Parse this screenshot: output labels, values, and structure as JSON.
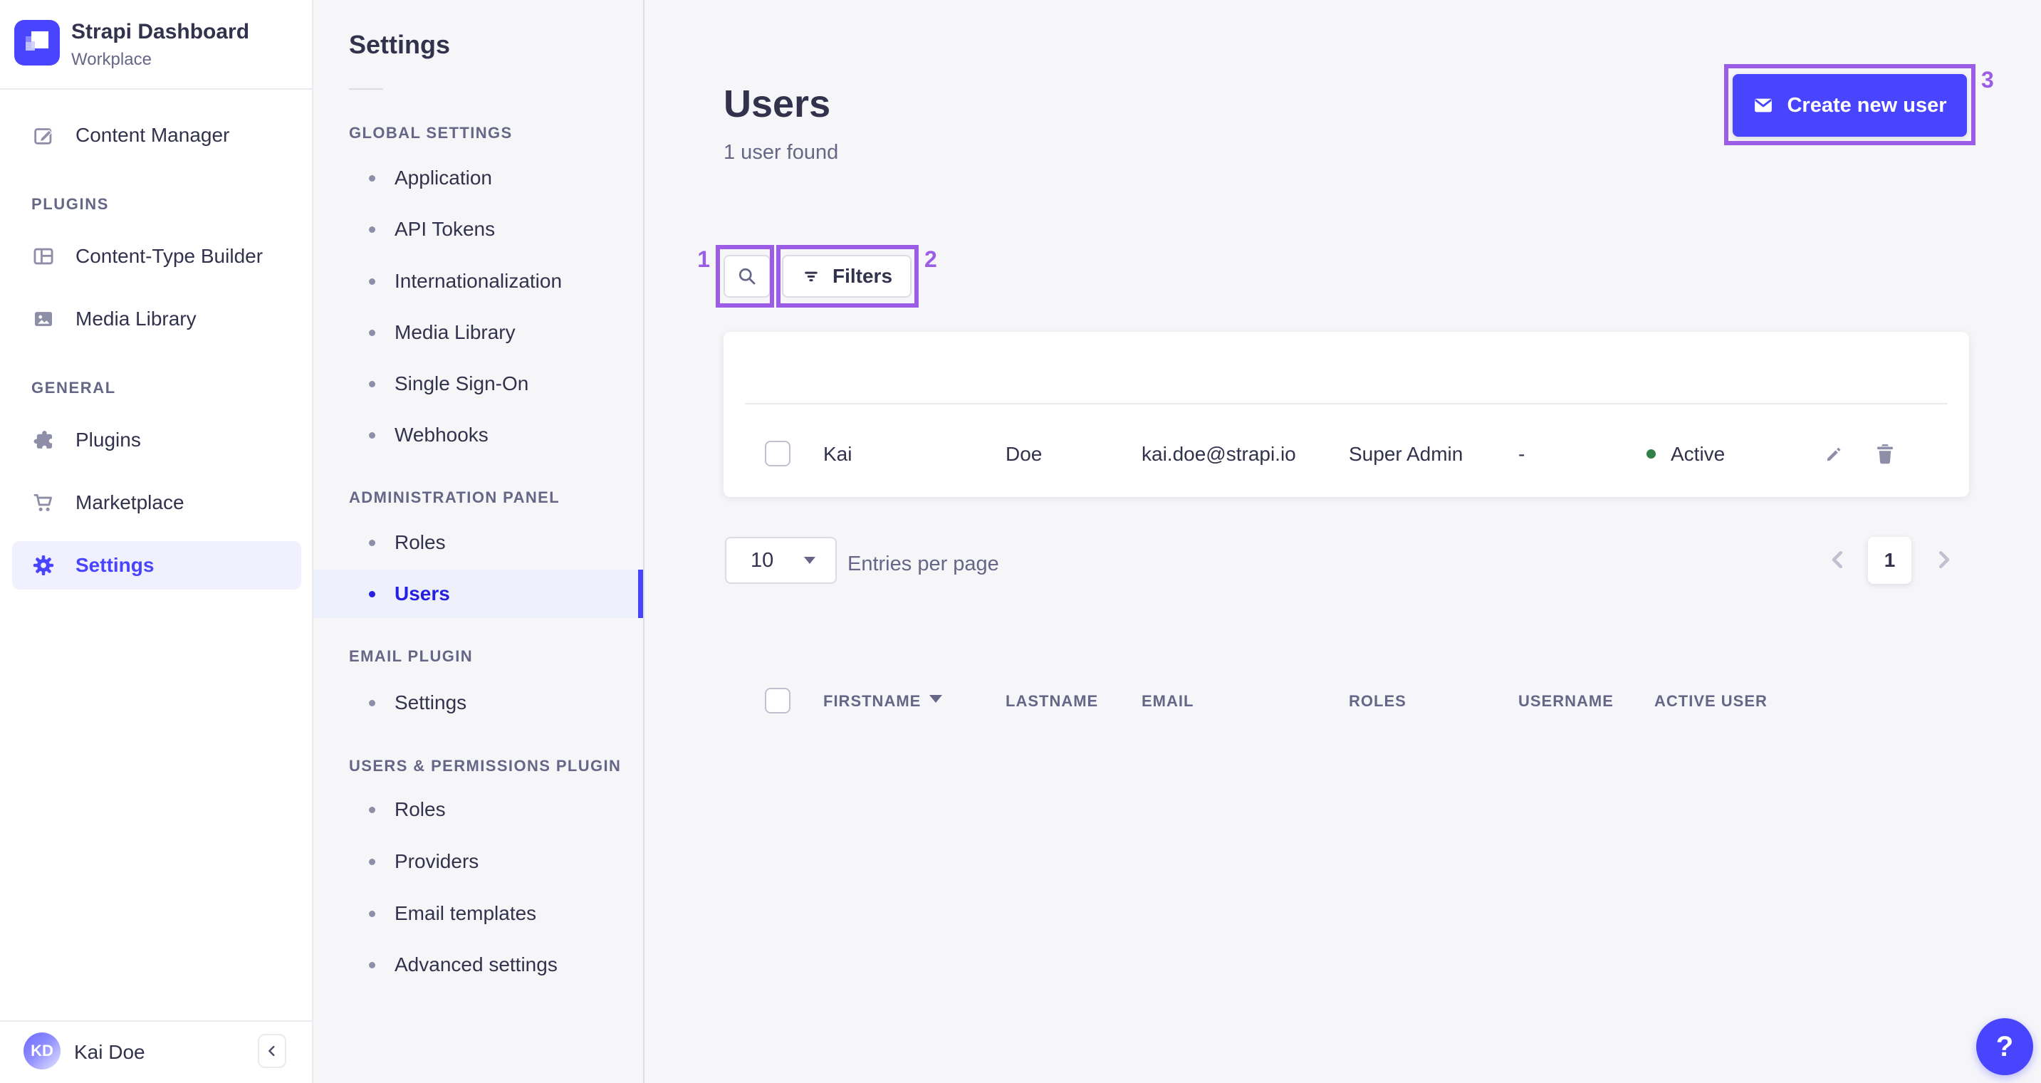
{
  "app": {
    "name": "Strapi Dashboard",
    "workspace": "Workplace"
  },
  "colors": {
    "accent": "#4945ff",
    "active_text": "#271fe0",
    "annotation": "#9b5de6",
    "success_dot": "#328048"
  },
  "sidebar": {
    "content_manager": "Content Manager",
    "sections": [
      {
        "label": "PLUGINS",
        "items": [
          "Content-Type Builder",
          "Media Library"
        ]
      },
      {
        "label": "GENERAL",
        "items": [
          "Plugins",
          "Marketplace",
          "Settings"
        ]
      }
    ],
    "user": {
      "initials": "KD",
      "name": "Kai Doe"
    }
  },
  "subnav": {
    "title": "Settings",
    "sections": [
      {
        "label": "GLOBAL SETTINGS",
        "items": [
          "Application",
          "API Tokens",
          "Internationalization",
          "Media Library",
          "Single Sign-On",
          "Webhooks"
        ]
      },
      {
        "label": "ADMINISTRATION PANEL",
        "items": [
          "Roles",
          "Users"
        ]
      },
      {
        "label": "EMAIL PLUGIN",
        "items": [
          "Settings"
        ]
      },
      {
        "label": "USERS & PERMISSIONS PLUGIN",
        "items": [
          "Roles",
          "Providers",
          "Email templates",
          "Advanced settings"
        ]
      }
    ],
    "active_item": "Users"
  },
  "main": {
    "title": "Users",
    "subtitle": "1 user found",
    "create_button": "Create new user",
    "filters_button": "Filters"
  },
  "table": {
    "columns": [
      "FIRSTNAME",
      "LASTNAME",
      "EMAIL",
      "ROLES",
      "USERNAME",
      "ACTIVE USER"
    ],
    "rows": [
      {
        "firstname": "Kai",
        "lastname": "Doe",
        "email": "kai.doe@strapi.io",
        "roles": "Super Admin",
        "username": "-",
        "active_label": "Active"
      }
    ]
  },
  "pagination": {
    "page_size": "10",
    "entries_label": "Entries per page",
    "page": "1"
  },
  "annotations": {
    "labels": [
      "1",
      "2",
      "3"
    ]
  },
  "help": {
    "label": "?"
  }
}
